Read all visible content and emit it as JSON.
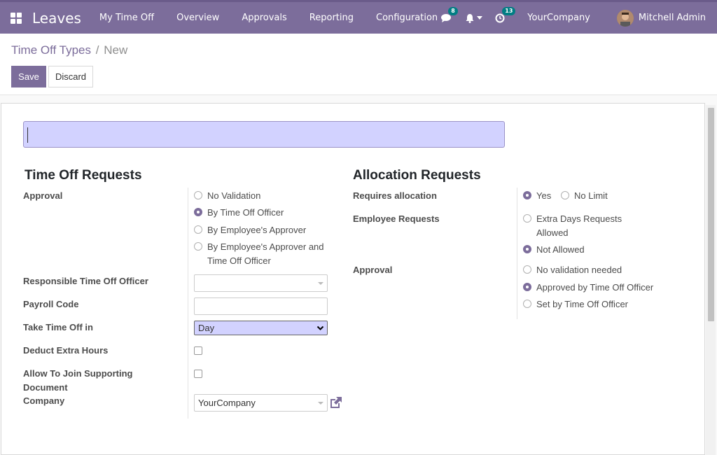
{
  "navbar": {
    "app_title": "Leaves",
    "menu": [
      "My Time Off",
      "Overview",
      "Approvals",
      "Reporting",
      "Configuration"
    ],
    "messages_count": "8",
    "activities_count": "13",
    "company": "YourCompany",
    "user": "Mitchell Admin"
  },
  "breadcrumb": {
    "parent": "Time Off Types",
    "separator": "/",
    "current": "New"
  },
  "buttons": {
    "save": "Save",
    "discard": "Discard"
  },
  "time_off": {
    "title": "Time Off Requests",
    "approval_label": "Approval",
    "approval_options": [
      "No Validation",
      "By Time Off Officer",
      "By Employee's Approver",
      "By Employee's Approver and Time Off Officer"
    ],
    "approval_selected": "By Time Off Officer",
    "responsible_label": "Responsible Time Off Officer",
    "responsible_value": "",
    "payroll_label": "Payroll Code",
    "payroll_value": "",
    "take_in_label": "Take Time Off in",
    "take_in_value": "Day",
    "deduct_label": "Deduct Extra Hours",
    "deduct_checked": false,
    "support_doc_label": "Allow To Join Supporting Document",
    "support_doc_checked": false,
    "company_label": "Company",
    "company_value": "YourCompany"
  },
  "allocation": {
    "title": "Allocation Requests",
    "requires_label": "Requires allocation",
    "requires_options": [
      "Yes",
      "No Limit"
    ],
    "requires_selected": "Yes",
    "employee_label": "Employee Requests",
    "employee_options": [
      "Extra Days Requests Allowed",
      "Not Allowed"
    ],
    "employee_selected": "Not Allowed",
    "approval_label": "Approval",
    "approval_options": [
      "No validation needed",
      "Approved by Time Off Officer",
      "Set by Time Off Officer"
    ],
    "approval_selected": "Approved by Time Off Officer"
  },
  "colors": {
    "brand": "#7c6d9b",
    "badge": "#017e84",
    "input_highlight": "#d2d2ff"
  }
}
